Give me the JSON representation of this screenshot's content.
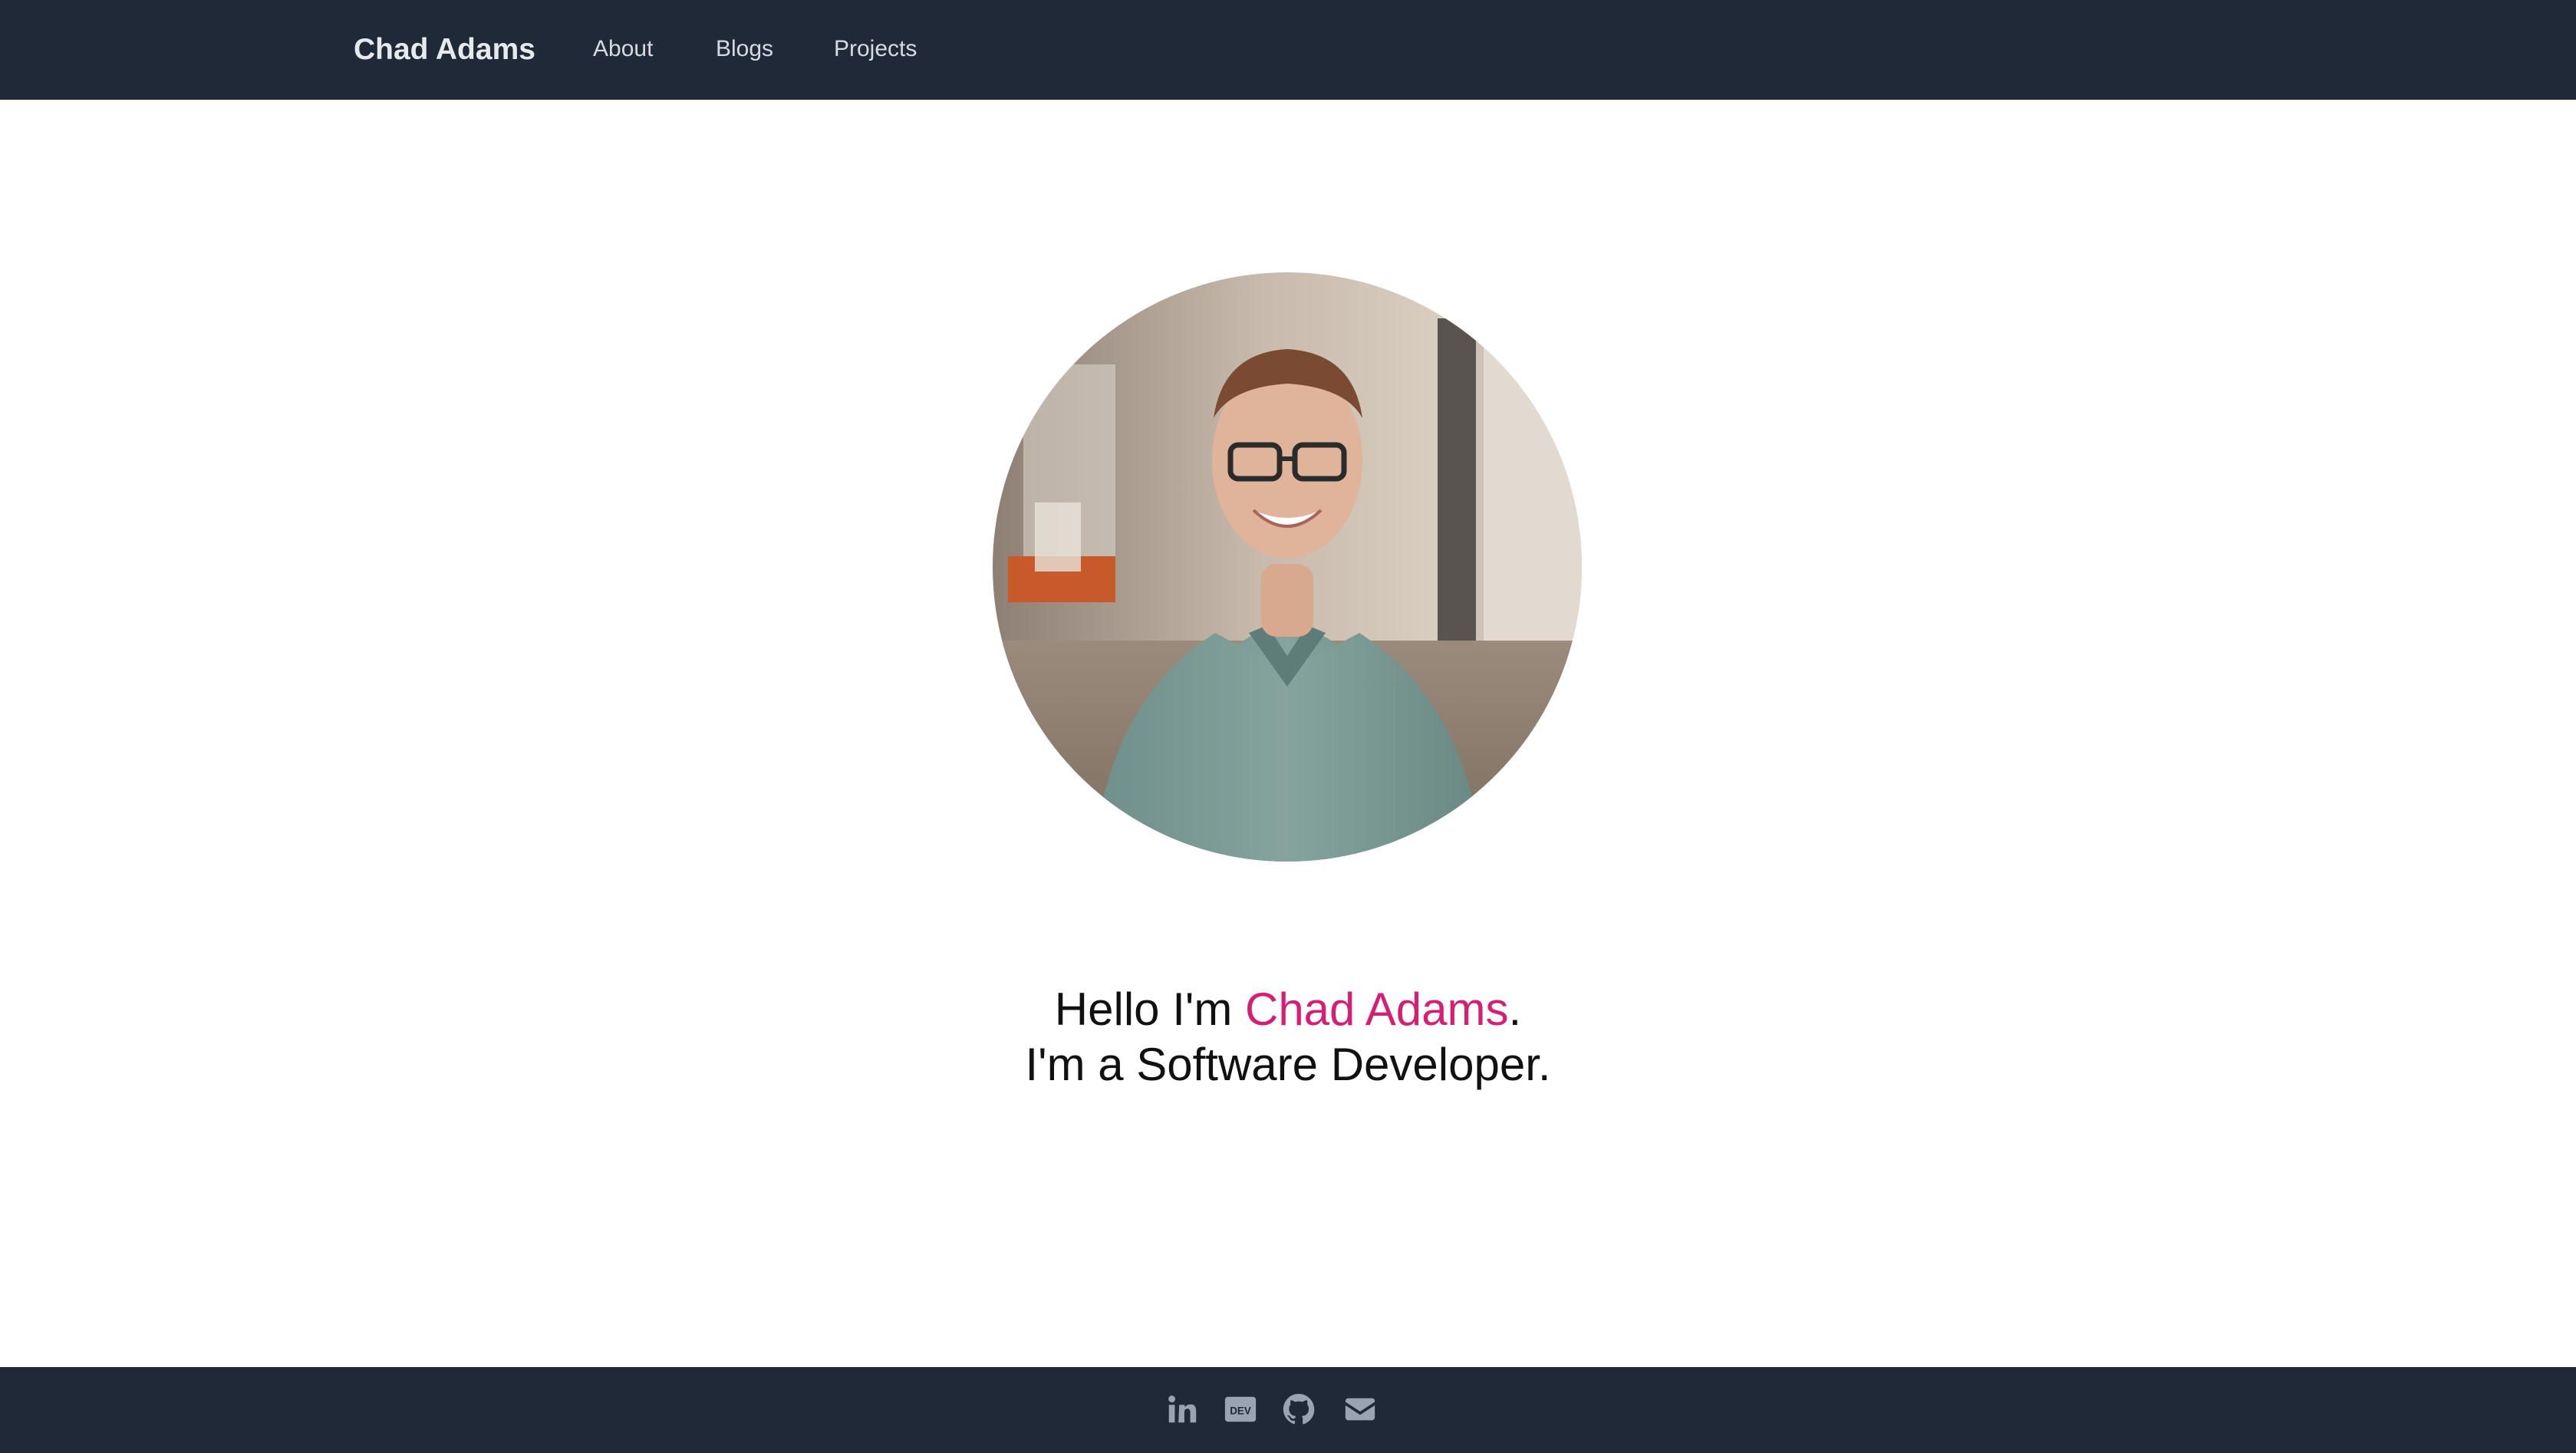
{
  "header": {
    "brand": "Chad Adams",
    "nav": [
      {
        "label": "About"
      },
      {
        "label": "Blogs"
      },
      {
        "label": "Projects"
      }
    ]
  },
  "hero": {
    "greeting_prefix": "Hello I'm ",
    "greeting_name": "Chad Adams",
    "greeting_suffix": ".",
    "tagline": "I'm a Software Developer."
  },
  "footer": {
    "icons": [
      "linkedin-icon",
      "dev-icon",
      "github-icon",
      "email-icon"
    ],
    "dev_icon_text": "DEV"
  },
  "colors": {
    "nav_bg": "#202938",
    "accent": "#d41f72",
    "icon_color": "#9aa3b2"
  }
}
